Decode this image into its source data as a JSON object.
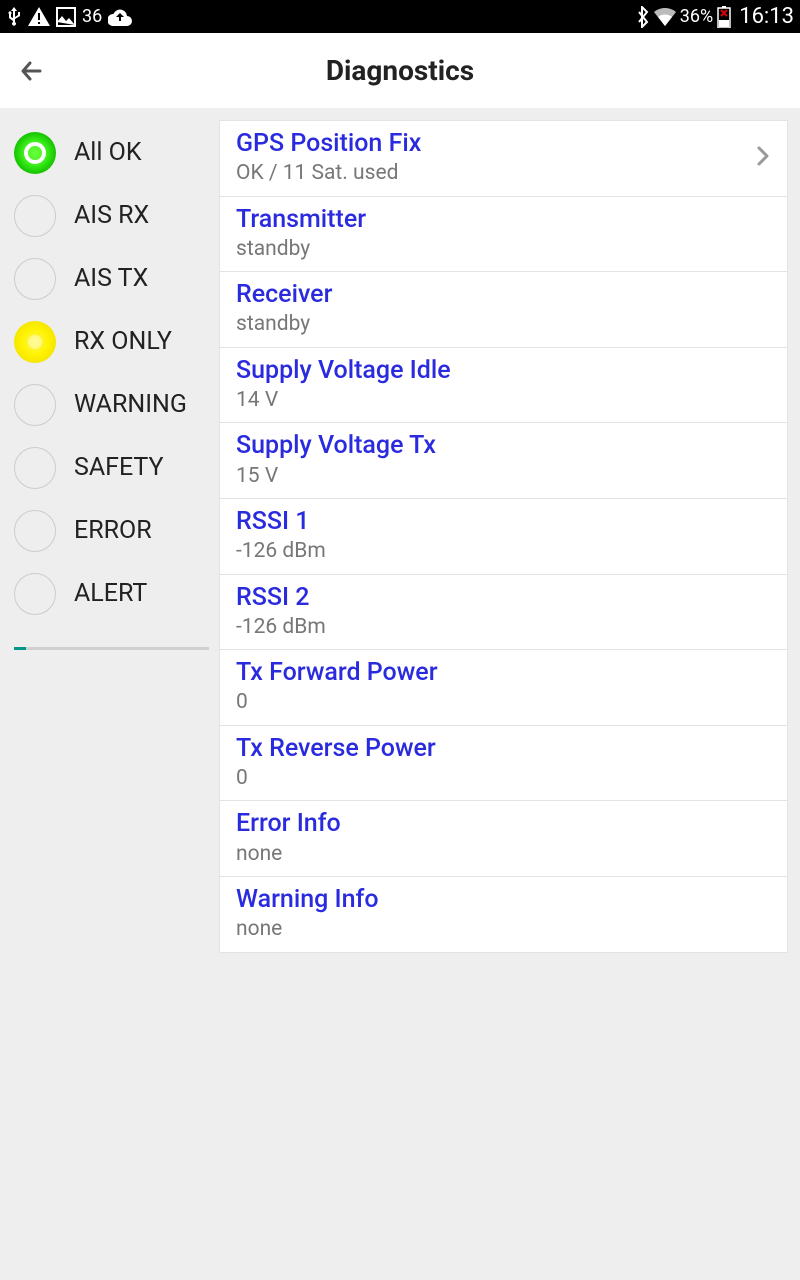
{
  "statusbar": {
    "left_number": "36",
    "battery_pct": "36%",
    "time": "16:13"
  },
  "header": {
    "title": "Diagnostics"
  },
  "sidebar": {
    "items": [
      {
        "label": "All OK",
        "dot": "green"
      },
      {
        "label": "AIS RX",
        "dot": "off"
      },
      {
        "label": "AIS TX",
        "dot": "off"
      },
      {
        "label": "RX ONLY",
        "dot": "yellow"
      },
      {
        "label": "WARNING",
        "dot": "off"
      },
      {
        "label": "SAFETY",
        "dot": "off"
      },
      {
        "label": "ERROR",
        "dot": "off"
      },
      {
        "label": "ALERT",
        "dot": "off"
      }
    ]
  },
  "diagnostics": [
    {
      "title": "GPS Position Fix",
      "value": "OK / 11 Sat. used",
      "chevron": true
    },
    {
      "title": "Transmitter",
      "value": "standby"
    },
    {
      "title": "Receiver",
      "value": "standby"
    },
    {
      "title": "Supply Voltage Idle",
      "value": "14 V"
    },
    {
      "title": "Supply Voltage Tx",
      "value": "15 V"
    },
    {
      "title": "RSSI 1",
      "value": "-126 dBm"
    },
    {
      "title": "RSSI 2",
      "value": "-126 dBm"
    },
    {
      "title": "Tx Forward Power",
      "value": "0"
    },
    {
      "title": "Tx Reverse Power",
      "value": "0"
    },
    {
      "title": "Error Info",
      "value": "none"
    },
    {
      "title": "Warning Info",
      "value": "none"
    }
  ]
}
